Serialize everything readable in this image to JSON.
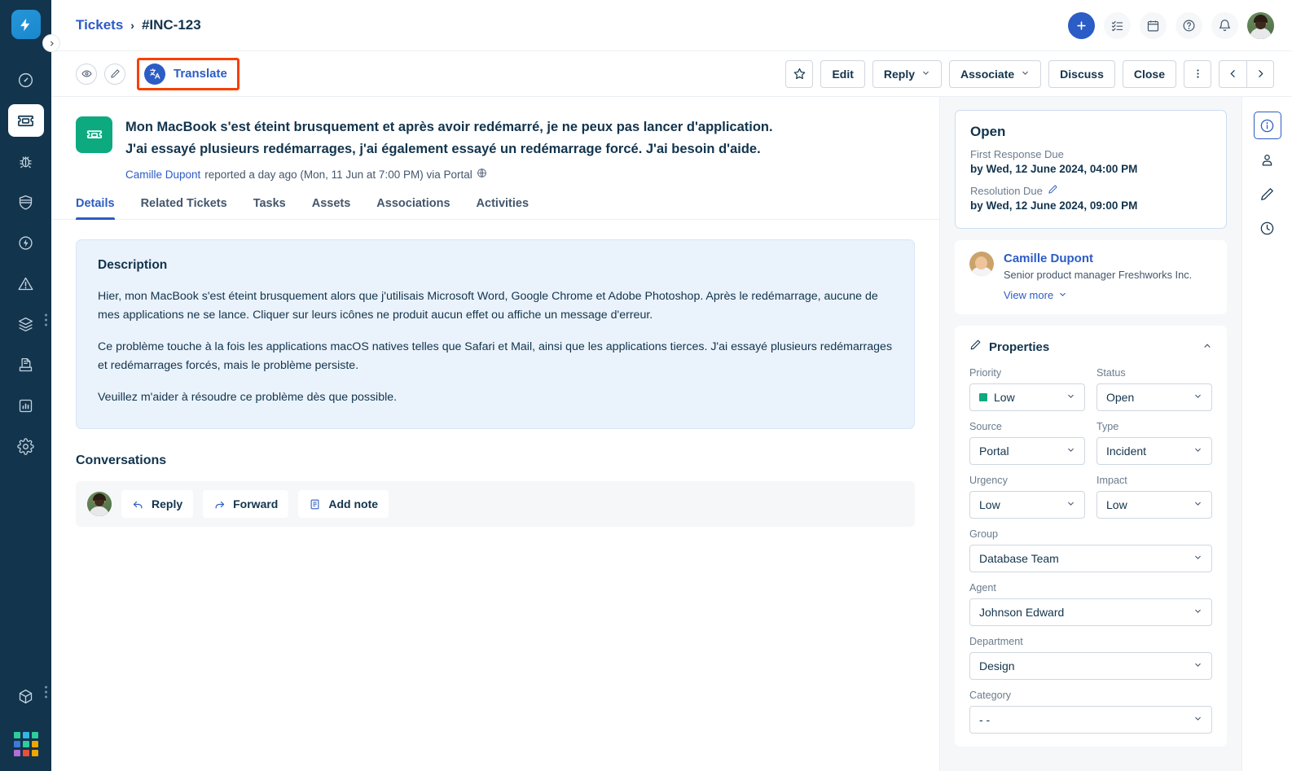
{
  "brand": {
    "name": "freshservice-logo",
    "accent": "#2596d9"
  },
  "left_rail": {
    "items": [
      {
        "name": "dashboard-icon",
        "label": "Dashboard"
      },
      {
        "name": "tickets-icon",
        "label": "Tickets",
        "active": true
      },
      {
        "name": "problems-bug-icon",
        "label": "Problems"
      },
      {
        "name": "changes-shield-icon",
        "label": "Changes"
      },
      {
        "name": "releases-bolt-icon",
        "label": "Releases"
      },
      {
        "name": "alerts-warning-icon",
        "label": "Alerts"
      },
      {
        "name": "assets-layers-icon",
        "label": "Assets"
      },
      {
        "name": "solutions-document-icon",
        "label": "Solutions"
      },
      {
        "name": "analytics-chart-icon",
        "label": "Analytics"
      },
      {
        "name": "admin-gear-icon",
        "label": "Admin"
      },
      {
        "name": "marketplace-cube-icon",
        "label": "Marketplace"
      }
    ],
    "app_switcher": {
      "name": "app-switcher-grid",
      "colors": [
        "#2ecc9b",
        "#33b5e5",
        "#2ecc9b",
        "#3d79d8",
        "#2ecc9b",
        "#f0a500",
        "#b06fd8",
        "#e8503a",
        "#f0a500"
      ]
    },
    "expander_icon": "chevron-right-icon"
  },
  "header": {
    "breadcrumb": {
      "root": "Tickets",
      "separator": "›",
      "current": "#INC-123"
    },
    "icons": [
      {
        "name": "create-new-button",
        "glyph": "plus"
      },
      {
        "name": "todo-checklist-icon",
        "glyph": "checklist"
      },
      {
        "name": "calendar-icon",
        "glyph": "calendar"
      },
      {
        "name": "help-icon",
        "glyph": "question"
      },
      {
        "name": "notifications-bell-icon",
        "glyph": "bell"
      }
    ],
    "avatar_name": "user-avatar"
  },
  "action_bar": {
    "watch_icon": "eye-icon",
    "edit_pencil_icon": "pencil-icon",
    "translate": {
      "label": "Translate",
      "icon": "translate-icon",
      "highlight_color": "#fa3f00"
    },
    "buttons": [
      {
        "name": "favorite-star-button",
        "label": "",
        "icon": "star-icon"
      },
      {
        "name": "edit-button",
        "label": "Edit"
      },
      {
        "name": "reply-button",
        "label": "Reply",
        "caret": true
      },
      {
        "name": "associate-button",
        "label": "Associate",
        "caret": true
      },
      {
        "name": "discuss-button",
        "label": "Discuss"
      },
      {
        "name": "close-button",
        "label": "Close"
      },
      {
        "name": "more-options-button",
        "label": "",
        "icon": "kebab-icon"
      }
    ],
    "prev_label": "‹",
    "next_label": "›"
  },
  "ticket": {
    "icon_name": "ticket-type-icon",
    "icon_color": "#0eaa7f",
    "subject_line1": "Mon MacBook s'est éteint brusquement et après avoir redémarré, je ne peux pas lancer d'application.",
    "subject_line2": "J'ai essayé plusieurs redémarrages, j'ai également essayé un redémarrage forcé. J'ai besoin d'aide.",
    "requester_link": "Camille Dupont",
    "meta_text": "reported a day ago (Mon, 11 Jun at 7:00 PM) via Portal",
    "channel_icon": "globe-icon"
  },
  "tabs": [
    {
      "name": "tab-details",
      "label": "Details",
      "active": true
    },
    {
      "name": "tab-related-tickets",
      "label": "Related Tickets",
      "active": false
    },
    {
      "name": "tab-tasks",
      "label": "Tasks",
      "active": false
    },
    {
      "name": "tab-assets",
      "label": "Assets",
      "active": false
    },
    {
      "name": "tab-associations",
      "label": "Associations",
      "active": false
    },
    {
      "name": "tab-activities",
      "label": "Activities",
      "active": false
    }
  ],
  "description": {
    "title": "Description",
    "paragraphs": [
      "Hier, mon MacBook s'est éteint brusquement alors que j'utilisais Microsoft Word, Google Chrome et Adobe Photoshop. Après le redémarrage, aucune de mes applications ne se lance. Cliquer sur leurs icônes ne produit aucun effet ou affiche un message d'erreur.",
      "Ce problème touche à la fois les applications macOS natives telles que Safari et Mail, ainsi que les applications tierces. J'ai essayé plusieurs redémarrages et redémarrages forcés, mais le problème persiste.",
      "Veuillez m'aider à résoudre ce problème dès que possible."
    ]
  },
  "conversations": {
    "title": "Conversations",
    "agent_avatar": "agent-avatar",
    "actions": [
      {
        "name": "reply-action-button",
        "label": "Reply",
        "icon": "reply-arrow-icon"
      },
      {
        "name": "forward-action-button",
        "label": "Forward",
        "icon": "forward-arrow-icon"
      },
      {
        "name": "add-note-action-button",
        "label": "Add note",
        "icon": "note-icon"
      }
    ]
  },
  "status_card": {
    "status": "Open",
    "first_response_label": "First Response Due",
    "first_response_value": "by Wed, 12 June 2024, 04:00 PM",
    "resolution_label": "Resolution Due",
    "resolution_edit_icon": "pencil-icon",
    "resolution_value": "by Wed, 12 June 2024, 09:00 PM"
  },
  "requester_card": {
    "avatar_name": "requester-avatar",
    "name": "Camille Dupont",
    "role": "Senior product manager Freshworks Inc.",
    "view_more_label": "View more",
    "chevron_icon": "chevron-down-icon"
  },
  "properties": {
    "title": "Properties",
    "edit_icon": "pencil-icon",
    "collapse_icon": "chevron-up-icon",
    "rows": [
      [
        {
          "name": "priority-select",
          "label": "Priority",
          "value": "Low",
          "swatch": "#0eaa7f"
        },
        {
          "name": "status-select",
          "label": "Status",
          "value": "Open"
        }
      ],
      [
        {
          "name": "source-select",
          "label": "Source",
          "value": "Portal"
        },
        {
          "name": "type-select",
          "label": "Type",
          "value": "Incident"
        }
      ],
      [
        {
          "name": "urgency-select",
          "label": "Urgency",
          "value": "Low"
        },
        {
          "name": "impact-select",
          "label": "Impact",
          "value": "Low"
        }
      ]
    ],
    "full_rows": [
      {
        "name": "group-select",
        "label": "Group",
        "value": "Database Team"
      },
      {
        "name": "agent-select",
        "label": "Agent",
        "value": "Johnson Edward"
      },
      {
        "name": "department-select",
        "label": "Department",
        "value": "Design"
      },
      {
        "name": "category-select",
        "label": "Category",
        "value": "- -"
      }
    ]
  },
  "right_rail": [
    {
      "name": "ticket-info-icon",
      "active": true
    },
    {
      "name": "contact-person-icon",
      "active": false
    },
    {
      "name": "edit-pencil-icon",
      "active": false
    },
    {
      "name": "activity-clock-icon",
      "active": false
    }
  ]
}
